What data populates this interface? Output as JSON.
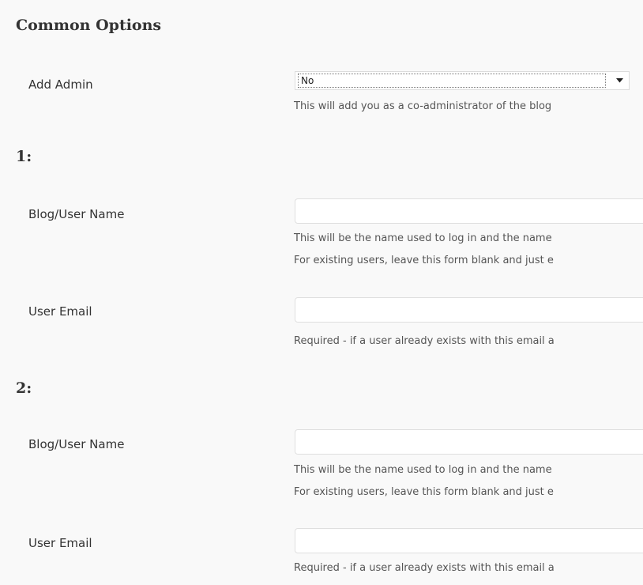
{
  "common_options": {
    "heading": "Common Options",
    "add_admin": {
      "label": "Add Admin",
      "selected_value": "No",
      "description": "This will add you as a co-administrator of the blog"
    }
  },
  "blogs": [
    {
      "heading": "1:",
      "blog_user_name": {
        "label": "Blog/User Name",
        "value": "",
        "description_1": "This will be the name used to log in and the name",
        "description_2": "For existing users, leave this form blank and just e"
      },
      "user_email": {
        "label": "User Email",
        "value": "",
        "description": "Required - if a user already exists with this email a"
      }
    },
    {
      "heading": "2:",
      "blog_user_name": {
        "label": "Blog/User Name",
        "value": "",
        "description_1": "This will be the name used to log in and the name",
        "description_2": "For existing users, leave this form blank and just e"
      },
      "user_email": {
        "label": "User Email",
        "value": "",
        "description": "Required - if a user already exists with this email a"
      }
    }
  ],
  "icons": {
    "select_arrow": "chevron-down-icon"
  }
}
